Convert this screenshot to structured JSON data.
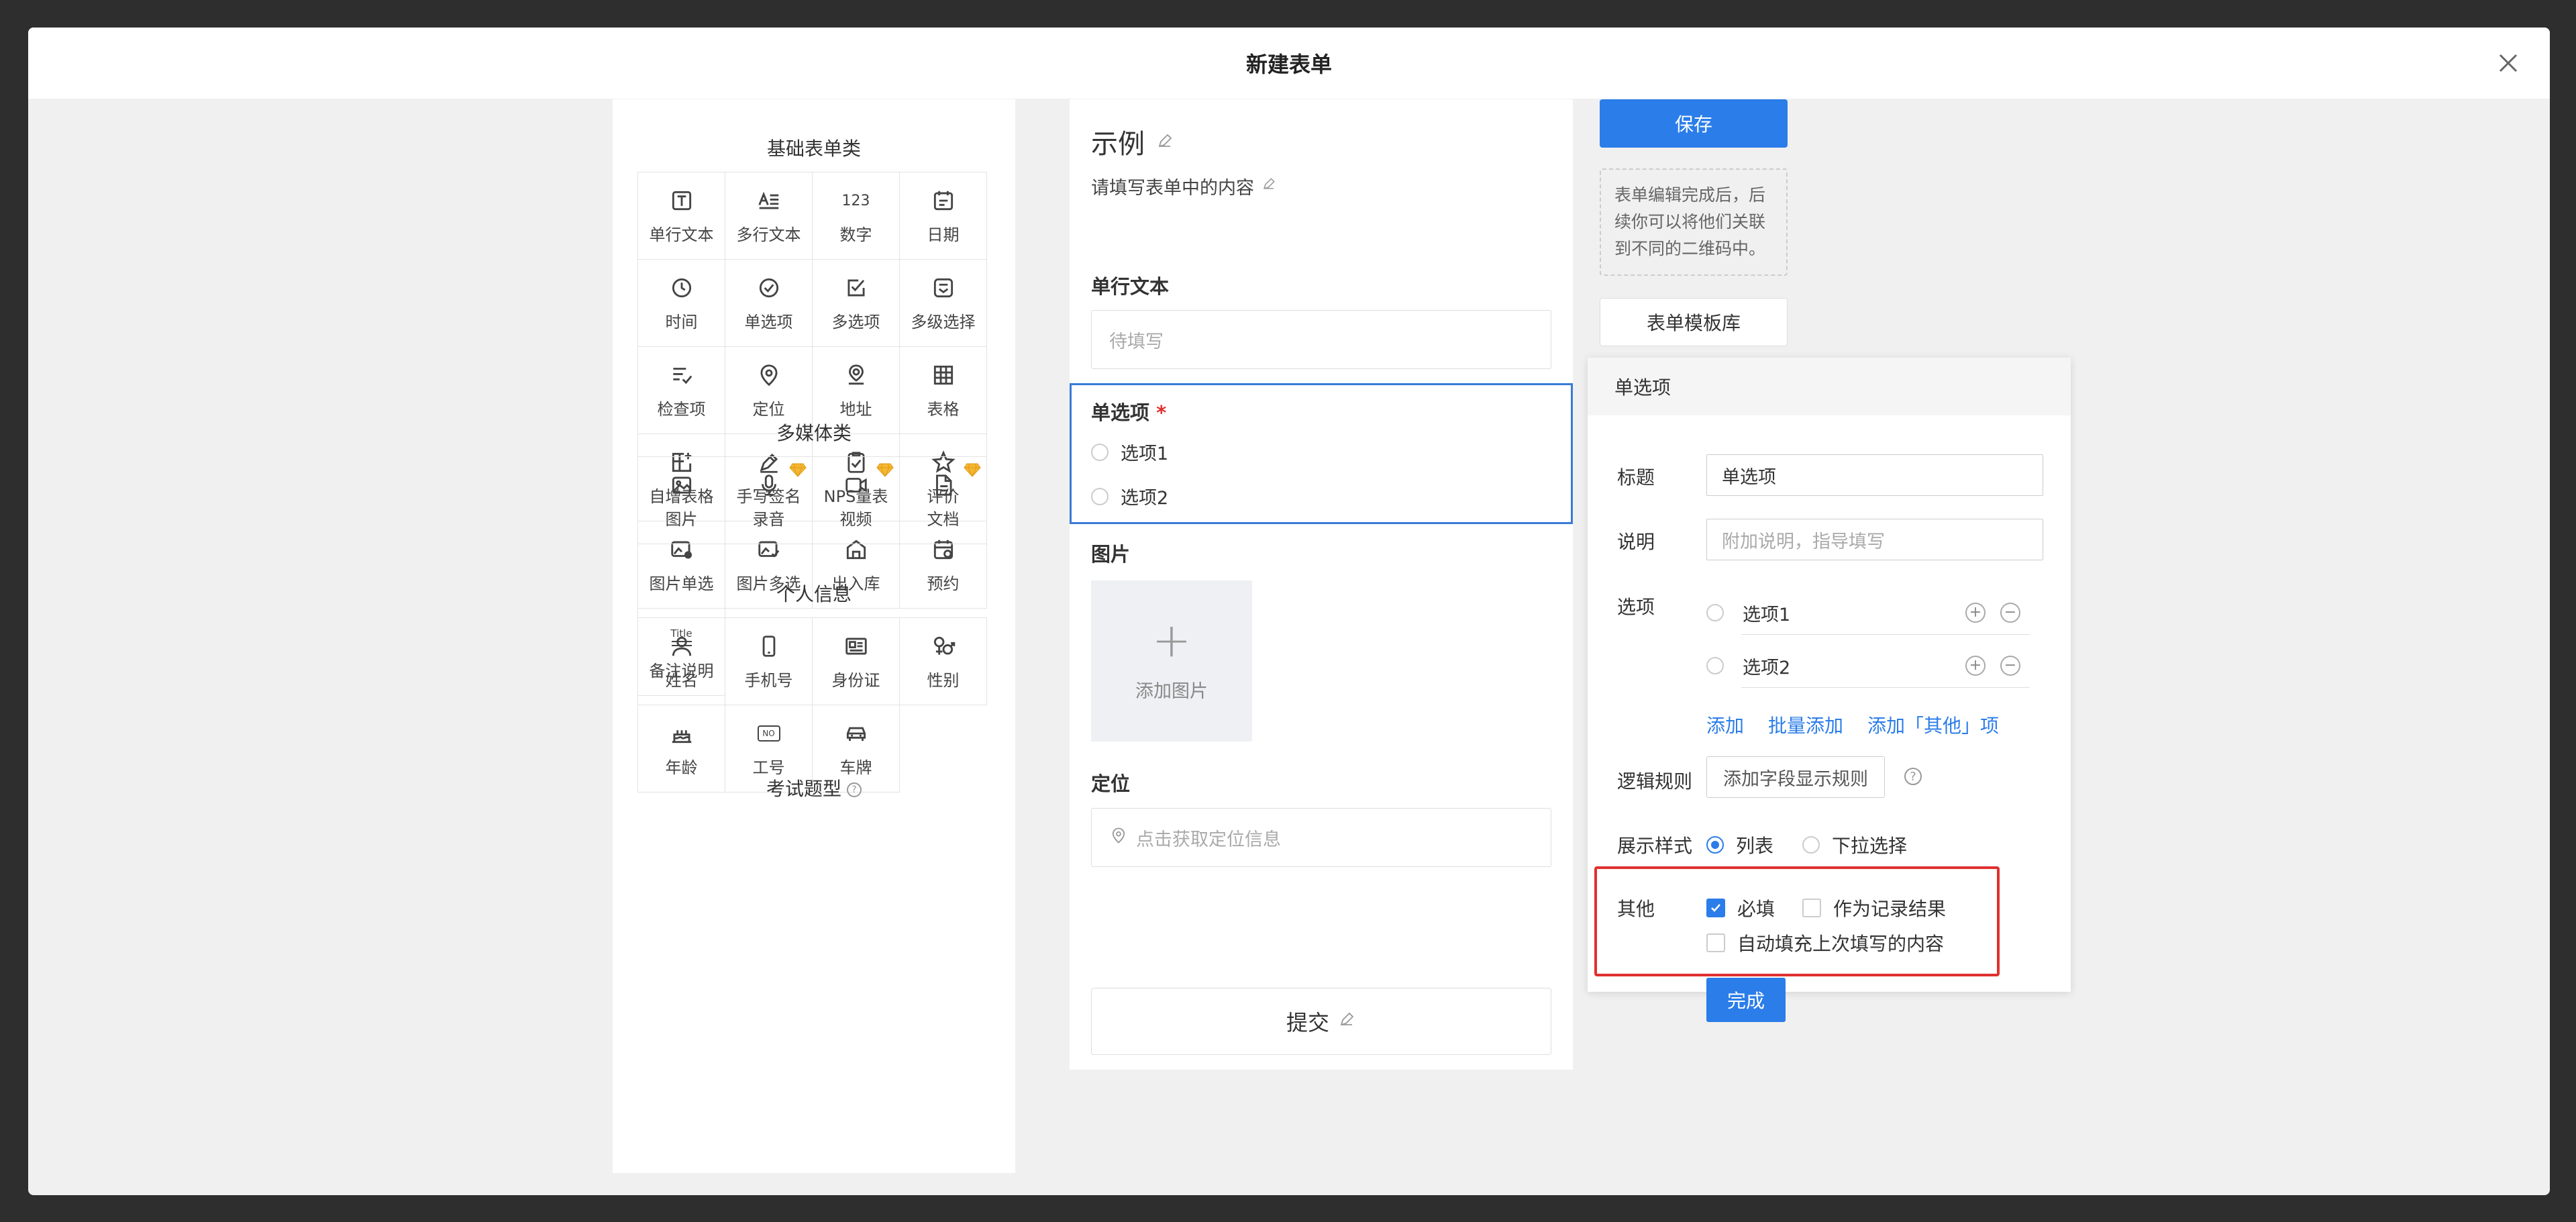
{
  "modal": {
    "title": "新建表单"
  },
  "palette": {
    "groups": [
      {
        "title": "基础表单类",
        "items": [
          {
            "label": "单行文本",
            "icon": "text-t-icon"
          },
          {
            "label": "多行文本",
            "icon": "multiline-icon"
          },
          {
            "label": "数字",
            "icon": "number-icon",
            "glyph": "123"
          },
          {
            "label": "日期",
            "icon": "calendar-icon"
          },
          {
            "label": "时间",
            "icon": "clock-icon"
          },
          {
            "label": "单选项",
            "icon": "check-circle-icon"
          },
          {
            "label": "多选项",
            "icon": "checkbox-icon"
          },
          {
            "label": "多级选择",
            "icon": "cascade-icon"
          },
          {
            "label": "检查项",
            "icon": "checklist-icon"
          },
          {
            "label": "定位",
            "icon": "location-pin-icon"
          },
          {
            "label": "地址",
            "icon": "address-icon"
          },
          {
            "label": "表格",
            "icon": "table-icon"
          },
          {
            "label": "自增表格",
            "icon": "table-plus-icon"
          },
          {
            "label": "手写签名",
            "icon": "pen-icon"
          },
          {
            "label": "NPS量表",
            "icon": "nps-icon"
          },
          {
            "label": "评价",
            "icon": "star-icon"
          },
          {
            "label": "图片单选",
            "icon": "image-radio-icon"
          },
          {
            "label": "图片多选",
            "icon": "image-check-icon"
          },
          {
            "label": "出入库",
            "icon": "warehouse-icon"
          },
          {
            "label": "预约",
            "icon": "reserve-icon"
          },
          {
            "label": "备注说明",
            "icon": "title-note-icon",
            "glyph": "Title"
          }
        ]
      },
      {
        "title": "多媒体类",
        "items": [
          {
            "label": "图片",
            "icon": "image-icon"
          },
          {
            "label": "录音",
            "icon": "microphone-icon",
            "premium": true
          },
          {
            "label": "视频",
            "icon": "video-icon",
            "premium": true
          },
          {
            "label": "文档",
            "icon": "document-icon",
            "premium": true
          }
        ]
      },
      {
        "title": "个人信息",
        "items": [
          {
            "label": "姓名",
            "icon": "person-icon"
          },
          {
            "label": "手机号",
            "icon": "phone-icon"
          },
          {
            "label": "身份证",
            "icon": "id-card-icon"
          },
          {
            "label": "性别",
            "icon": "gender-icon"
          },
          {
            "label": "年龄",
            "icon": "cake-icon"
          },
          {
            "label": "工号",
            "icon": "badge-no-icon",
            "glyph": "NO"
          },
          {
            "label": "车牌",
            "icon": "car-icon"
          }
        ]
      },
      {
        "title": "考试题型"
      }
    ]
  },
  "preview": {
    "title": "示例",
    "description": "请填写表单中的内容",
    "text_field": {
      "label": "单行文本",
      "placeholder": "待填写"
    },
    "radio_field": {
      "label": "单选项",
      "required_mark": "*",
      "options": [
        "选项1",
        "选项2"
      ]
    },
    "image_field": {
      "label": "图片",
      "upload_label": "添加图片"
    },
    "location_field": {
      "label": "定位",
      "placeholder": "点击获取定位信息"
    },
    "submit_label": "提交"
  },
  "sidebar": {
    "save_label": "保存",
    "tip": "表单编辑完成后，后续你可以将他们关联到不同的二维码中。",
    "template_label": "表单模板库"
  },
  "props": {
    "header": "单选项",
    "title_label": "标题",
    "title_value": "单选项",
    "desc_label": "说明",
    "desc_placeholder": "附加说明，指导填写",
    "options_label": "选项",
    "options": [
      "选项1",
      "选项2"
    ],
    "add_link": "添加",
    "bulk_add_link": "批量添加",
    "add_other_link": "添加「其他」项",
    "logic_label": "逻辑规则",
    "logic_button": "添加字段显示规则",
    "display_label": "展示样式",
    "display_list": "列表",
    "display_dropdown": "下拉选择",
    "other_label": "其他",
    "required_label": "必填",
    "record_label": "作为记录结果",
    "autofill_label": "自动填充上次填写的内容",
    "done_label": "完成"
  },
  "colors": {
    "primary": "#2b7de9",
    "highlight": "#e03030"
  }
}
